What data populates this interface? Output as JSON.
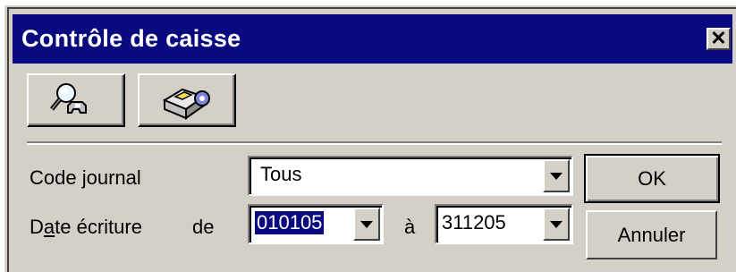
{
  "window": {
    "title": "Contrôle de caisse",
    "close_label": "✕"
  },
  "toolbar": {
    "buttons": [
      {
        "icon": "search-icon"
      },
      {
        "icon": "cash-register-icon"
      }
    ]
  },
  "form": {
    "journal_label": "Code journal",
    "journal_value": "Tous",
    "date_label_prefix": "D",
    "date_label_underlined": "a",
    "date_label_suffix": "te écriture",
    "from_label": "de",
    "from_value": "010105",
    "to_label": "à",
    "to_value": "311205"
  },
  "buttons": {
    "ok_label": "OK",
    "cancel_label": "Annuler"
  },
  "colors": {
    "titlebar": "#0a0a80",
    "face": "#d4d0c8",
    "selection": "#0a0a80"
  }
}
